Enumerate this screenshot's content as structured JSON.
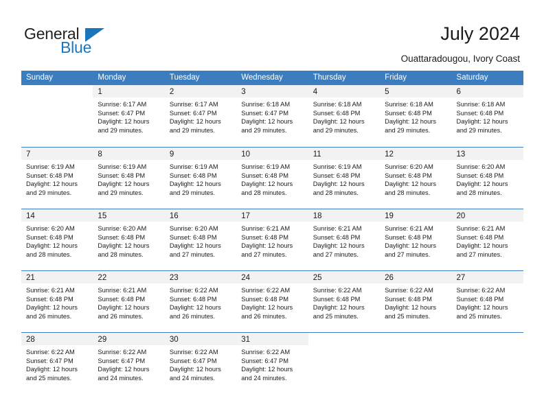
{
  "brand": {
    "name_top": "General",
    "name_bottom": "Blue",
    "triangle_icon": "triangle-icon",
    "color_primary": "#1b75bb",
    "color_text": "#231f20"
  },
  "header": {
    "title": "July 2024",
    "subtitle": "Ouattaradougou, Ivory Coast"
  },
  "calendar": {
    "header_bg": "#3b7dbf",
    "daynum_bg": "#f2f2f2",
    "day_names": [
      "Sunday",
      "Monday",
      "Tuesday",
      "Wednesday",
      "Thursday",
      "Friday",
      "Saturday"
    ],
    "weeks": [
      [
        {
          "day": "",
          "empty": true,
          "sunrise": "",
          "sunset": "",
          "daylight": ""
        },
        {
          "day": "1",
          "sunrise": "Sunrise: 6:17 AM",
          "sunset": "Sunset: 6:47 PM",
          "daylight": "Daylight: 12 hours and 29 minutes."
        },
        {
          "day": "2",
          "sunrise": "Sunrise: 6:17 AM",
          "sunset": "Sunset: 6:47 PM",
          "daylight": "Daylight: 12 hours and 29 minutes."
        },
        {
          "day": "3",
          "sunrise": "Sunrise: 6:18 AM",
          "sunset": "Sunset: 6:47 PM",
          "daylight": "Daylight: 12 hours and 29 minutes."
        },
        {
          "day": "4",
          "sunrise": "Sunrise: 6:18 AM",
          "sunset": "Sunset: 6:48 PM",
          "daylight": "Daylight: 12 hours and 29 minutes."
        },
        {
          "day": "5",
          "sunrise": "Sunrise: 6:18 AM",
          "sunset": "Sunset: 6:48 PM",
          "daylight": "Daylight: 12 hours and 29 minutes."
        },
        {
          "day": "6",
          "sunrise": "Sunrise: 6:18 AM",
          "sunset": "Sunset: 6:48 PM",
          "daylight": "Daylight: 12 hours and 29 minutes."
        }
      ],
      [
        {
          "day": "7",
          "sunrise": "Sunrise: 6:19 AM",
          "sunset": "Sunset: 6:48 PM",
          "daylight": "Daylight: 12 hours and 29 minutes."
        },
        {
          "day": "8",
          "sunrise": "Sunrise: 6:19 AM",
          "sunset": "Sunset: 6:48 PM",
          "daylight": "Daylight: 12 hours and 29 minutes."
        },
        {
          "day": "9",
          "sunrise": "Sunrise: 6:19 AM",
          "sunset": "Sunset: 6:48 PM",
          "daylight": "Daylight: 12 hours and 29 minutes."
        },
        {
          "day": "10",
          "sunrise": "Sunrise: 6:19 AM",
          "sunset": "Sunset: 6:48 PM",
          "daylight": "Daylight: 12 hours and 28 minutes."
        },
        {
          "day": "11",
          "sunrise": "Sunrise: 6:19 AM",
          "sunset": "Sunset: 6:48 PM",
          "daylight": "Daylight: 12 hours and 28 minutes."
        },
        {
          "day": "12",
          "sunrise": "Sunrise: 6:20 AM",
          "sunset": "Sunset: 6:48 PM",
          "daylight": "Daylight: 12 hours and 28 minutes."
        },
        {
          "day": "13",
          "sunrise": "Sunrise: 6:20 AM",
          "sunset": "Sunset: 6:48 PM",
          "daylight": "Daylight: 12 hours and 28 minutes."
        }
      ],
      [
        {
          "day": "14",
          "sunrise": "Sunrise: 6:20 AM",
          "sunset": "Sunset: 6:48 PM",
          "daylight": "Daylight: 12 hours and 28 minutes."
        },
        {
          "day": "15",
          "sunrise": "Sunrise: 6:20 AM",
          "sunset": "Sunset: 6:48 PM",
          "daylight": "Daylight: 12 hours and 28 minutes."
        },
        {
          "day": "16",
          "sunrise": "Sunrise: 6:20 AM",
          "sunset": "Sunset: 6:48 PM",
          "daylight": "Daylight: 12 hours and 27 minutes."
        },
        {
          "day": "17",
          "sunrise": "Sunrise: 6:21 AM",
          "sunset": "Sunset: 6:48 PM",
          "daylight": "Daylight: 12 hours and 27 minutes."
        },
        {
          "day": "18",
          "sunrise": "Sunrise: 6:21 AM",
          "sunset": "Sunset: 6:48 PM",
          "daylight": "Daylight: 12 hours and 27 minutes."
        },
        {
          "day": "19",
          "sunrise": "Sunrise: 6:21 AM",
          "sunset": "Sunset: 6:48 PM",
          "daylight": "Daylight: 12 hours and 27 minutes."
        },
        {
          "day": "20",
          "sunrise": "Sunrise: 6:21 AM",
          "sunset": "Sunset: 6:48 PM",
          "daylight": "Daylight: 12 hours and 27 minutes."
        }
      ],
      [
        {
          "day": "21",
          "sunrise": "Sunrise: 6:21 AM",
          "sunset": "Sunset: 6:48 PM",
          "daylight": "Daylight: 12 hours and 26 minutes."
        },
        {
          "day": "22",
          "sunrise": "Sunrise: 6:21 AM",
          "sunset": "Sunset: 6:48 PM",
          "daylight": "Daylight: 12 hours and 26 minutes."
        },
        {
          "day": "23",
          "sunrise": "Sunrise: 6:22 AM",
          "sunset": "Sunset: 6:48 PM",
          "daylight": "Daylight: 12 hours and 26 minutes."
        },
        {
          "day": "24",
          "sunrise": "Sunrise: 6:22 AM",
          "sunset": "Sunset: 6:48 PM",
          "daylight": "Daylight: 12 hours and 26 minutes."
        },
        {
          "day": "25",
          "sunrise": "Sunrise: 6:22 AM",
          "sunset": "Sunset: 6:48 PM",
          "daylight": "Daylight: 12 hours and 25 minutes."
        },
        {
          "day": "26",
          "sunrise": "Sunrise: 6:22 AM",
          "sunset": "Sunset: 6:48 PM",
          "daylight": "Daylight: 12 hours and 25 minutes."
        },
        {
          "day": "27",
          "sunrise": "Sunrise: 6:22 AM",
          "sunset": "Sunset: 6:48 PM",
          "daylight": "Daylight: 12 hours and 25 minutes."
        }
      ],
      [
        {
          "day": "28",
          "sunrise": "Sunrise: 6:22 AM",
          "sunset": "Sunset: 6:47 PM",
          "daylight": "Daylight: 12 hours and 25 minutes."
        },
        {
          "day": "29",
          "sunrise": "Sunrise: 6:22 AM",
          "sunset": "Sunset: 6:47 PM",
          "daylight": "Daylight: 12 hours and 24 minutes."
        },
        {
          "day": "30",
          "sunrise": "Sunrise: 6:22 AM",
          "sunset": "Sunset: 6:47 PM",
          "daylight": "Daylight: 12 hours and 24 minutes."
        },
        {
          "day": "31",
          "sunrise": "Sunrise: 6:22 AM",
          "sunset": "Sunset: 6:47 PM",
          "daylight": "Daylight: 12 hours and 24 minutes."
        },
        {
          "day": "",
          "empty": true,
          "sunrise": "",
          "sunset": "",
          "daylight": ""
        },
        {
          "day": "",
          "empty": true,
          "sunrise": "",
          "sunset": "",
          "daylight": ""
        },
        {
          "day": "",
          "empty": true,
          "sunrise": "",
          "sunset": "",
          "daylight": ""
        }
      ]
    ]
  }
}
